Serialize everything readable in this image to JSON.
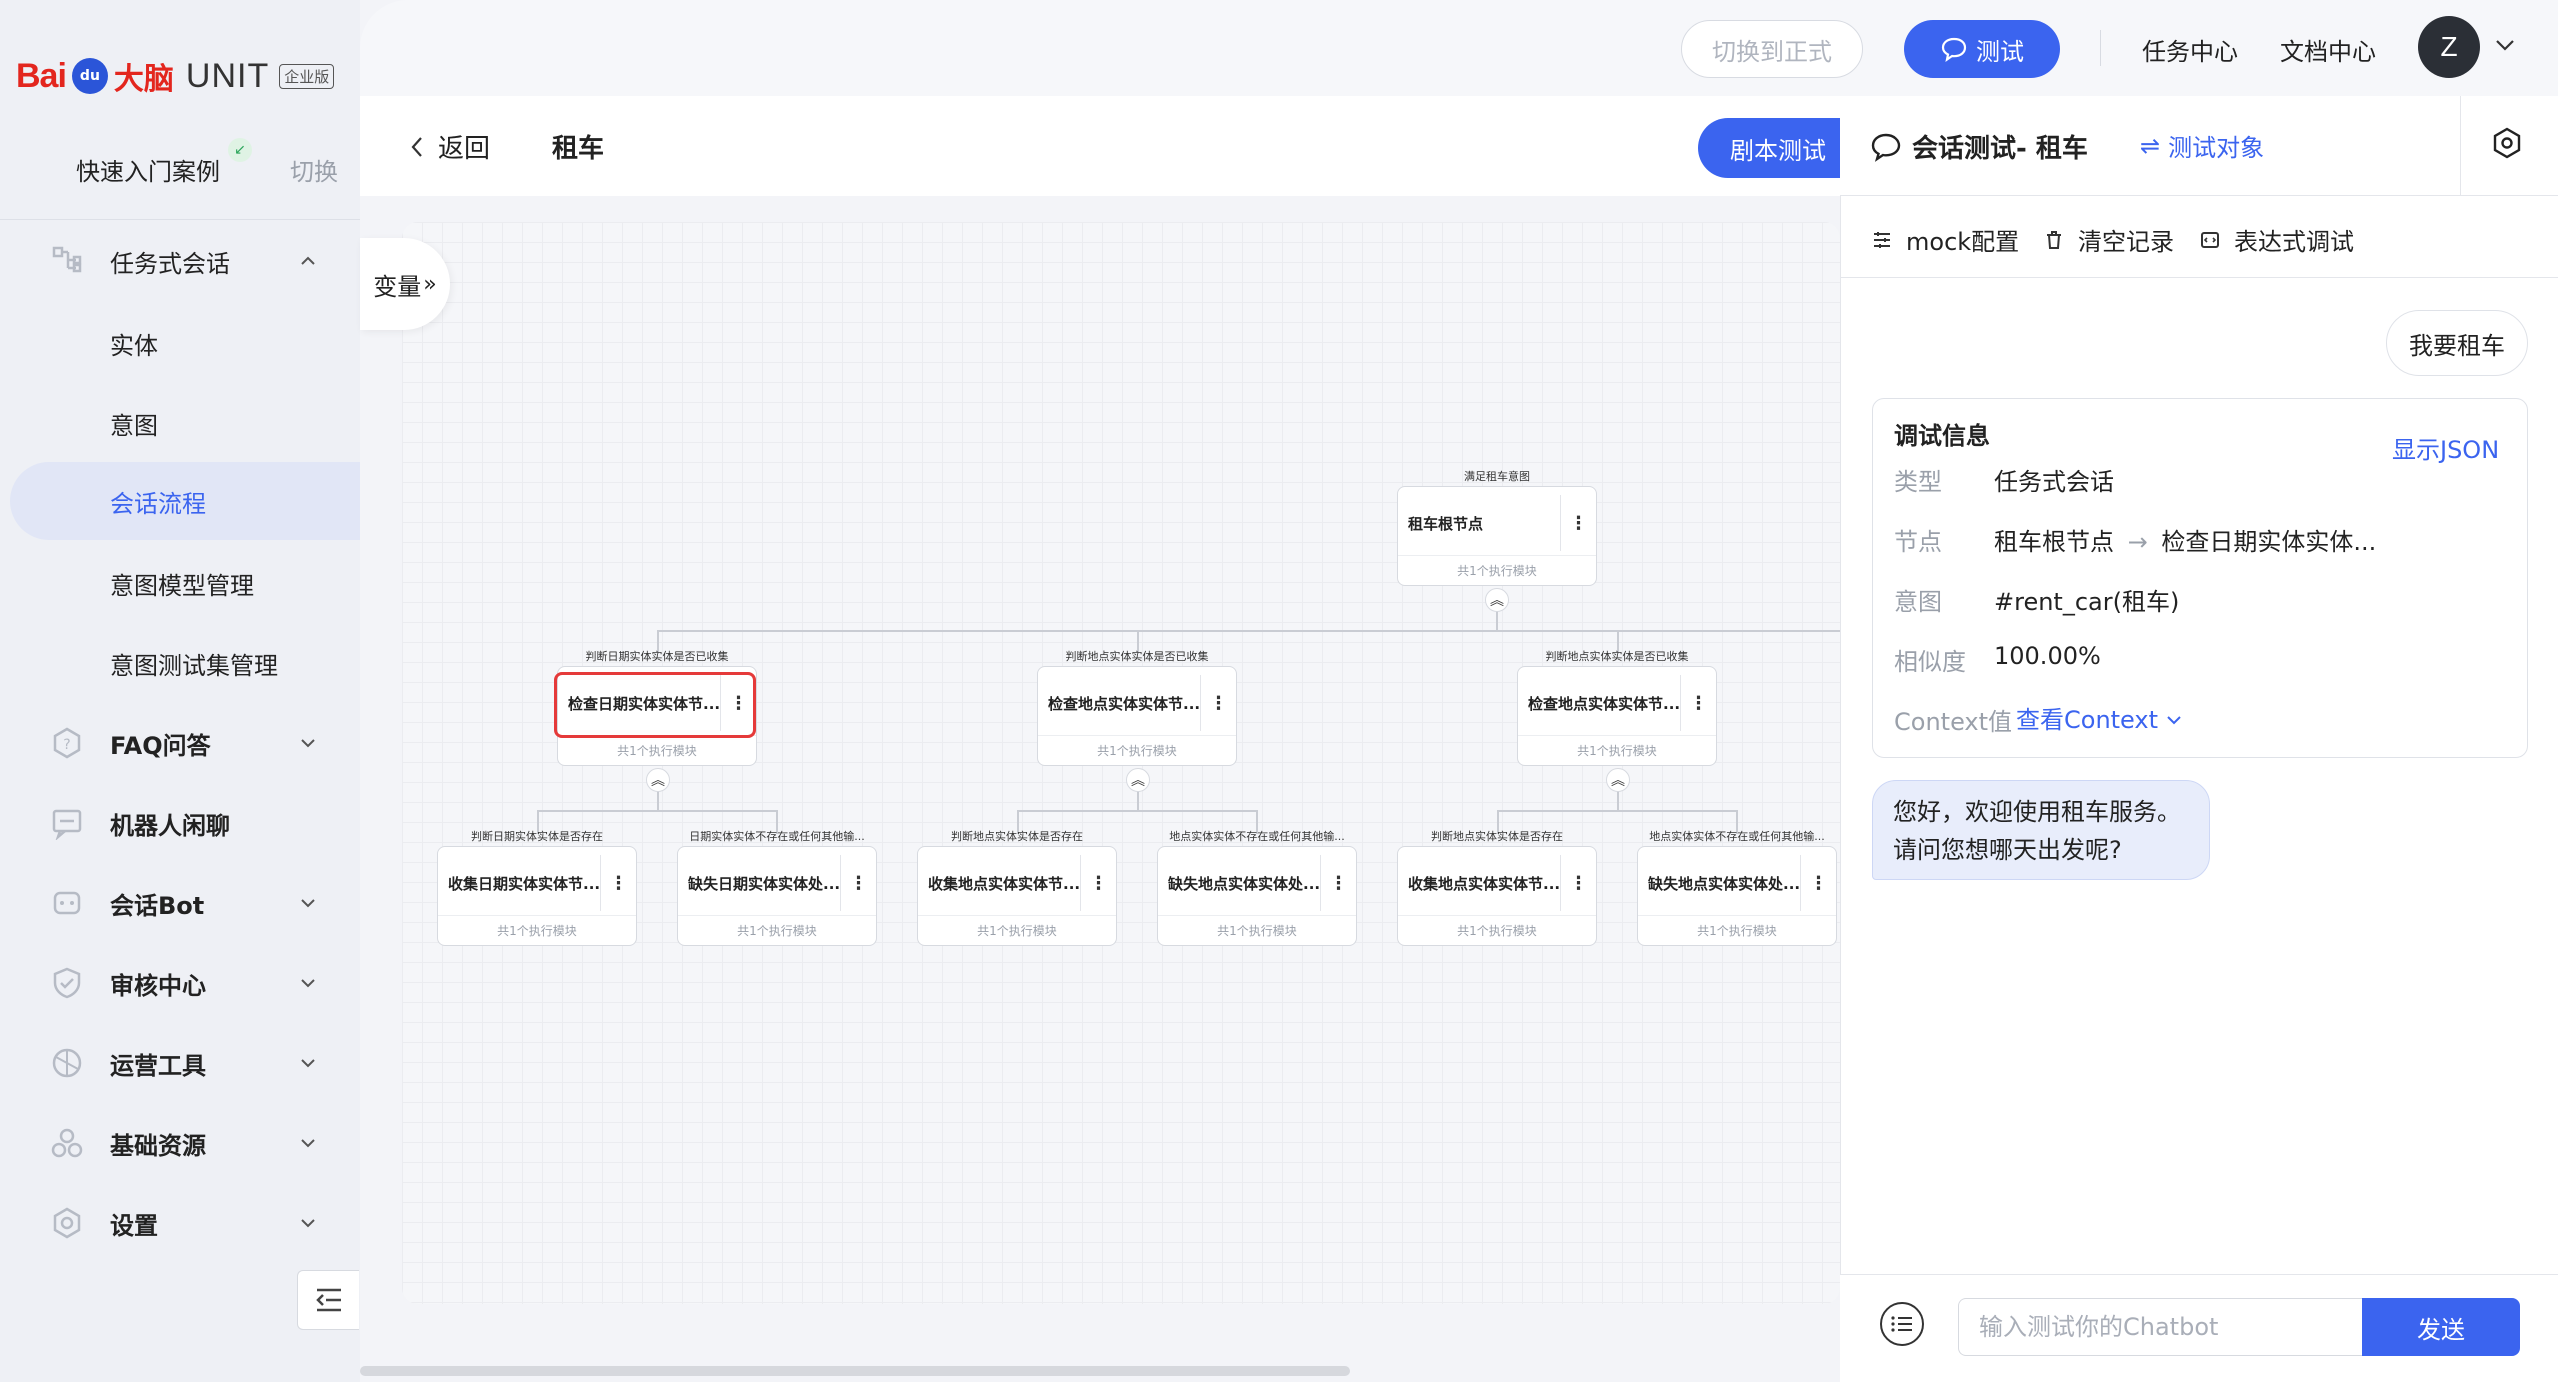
{
  "brand": {
    "bai": "Bai",
    "du": "du",
    "danao": "大脑",
    "unit": "UNIT",
    "edition": "企业版"
  },
  "sidebar": {
    "quick_start": "快速入门案例",
    "switch": "切换",
    "menu": [
      {
        "label": "任务式会话",
        "icon": "task-dialog-icon"
      },
      {
        "label": "FAQ问答",
        "icon": "faq-icon"
      },
      {
        "label": "机器人闲聊",
        "icon": "chat-icon"
      },
      {
        "label": "会话Bot",
        "icon": "bot-icon"
      },
      {
        "label": "审核中心",
        "icon": "shield-icon"
      },
      {
        "label": "运营工具",
        "icon": "ops-tool-icon"
      },
      {
        "label": "基础资源",
        "icon": "resource-icon"
      },
      {
        "label": "设置",
        "icon": "gear-icon"
      }
    ],
    "sub_items": [
      "实体",
      "意图",
      "会话流程",
      "意图模型管理",
      "意图测试集管理"
    ],
    "active_sub": "会话流程"
  },
  "topbar": {
    "switch_prod": "切换到正式",
    "test": "测试",
    "task_center": "任务中心",
    "doc_center": "文档中心",
    "avatar": "Z"
  },
  "main": {
    "back": "返回",
    "title": "租车",
    "script_test": "剧本测试",
    "var_tab": "变量"
  },
  "flow": {
    "root": {
      "caption": "满足租车意图",
      "label": "租车根节点",
      "footer": "共1个执行模块"
    },
    "level1": [
      {
        "caption": "判断日期实体实体是否已收集",
        "label": "检查日期实体实体节...",
        "footer": "共1个执行模块",
        "selected": true
      },
      {
        "caption": "判断地点实体实体是否已收集",
        "label": "检查地点实体实体节...",
        "footer": "共1个执行模块"
      },
      {
        "caption": "判断地点实体实体是否已收集",
        "label": "检查地点实体实体节...",
        "footer": "共1个执行模块"
      }
    ],
    "level2": [
      {
        "caption": "判断日期实体实体是否存在",
        "label": "收集日期实体实体节...",
        "footer": "共1个执行模块"
      },
      {
        "caption": "日期实体实体不存在或任何其他输...",
        "label": "缺失日期实体实体处...",
        "footer": "共1个执行模块"
      },
      {
        "caption": "判断地点实体实体是否存在",
        "label": "收集地点实体实体节...",
        "footer": "共1个执行模块"
      },
      {
        "caption": "地点实体实体不存在或任何其他输...",
        "label": "缺失地点实体实体处...",
        "footer": "共1个执行模块"
      },
      {
        "caption": "判断地点实体实体是否存在",
        "label": "收集地点实体实体节...",
        "footer": "共1个执行模块"
      },
      {
        "caption": "地点实体实体不存在或任何其他输...",
        "label": "缺失地点实体实体处...",
        "footer": "共1个执行模块"
      }
    ]
  },
  "panel": {
    "title": "会话测试- 租车",
    "target": "测试对象",
    "tools": {
      "mock": "mock配置",
      "clear": "清空记录",
      "expr": "表达式调试"
    },
    "user_msg": "我要租车",
    "debug": {
      "title": "调试信息",
      "show_json": "显示JSON",
      "type_key": "类型",
      "type_val": "任务式会话",
      "node_key": "节点",
      "node_from": "租车根节点",
      "node_to": "检查日期实体实体...",
      "intent_key": "意图",
      "intent_val": "#rent_car(租车)",
      "sim_key": "相似度",
      "sim_val": "100.00%",
      "ctx_key": "Context值",
      "ctx_link": "查看Context"
    },
    "bot_msg_1": "您好，欢迎使用租车服务。",
    "bot_msg_2": "请问您想哪天出发呢?",
    "input_placeholder": "输入测试你的Chatbot",
    "send": "发送"
  }
}
